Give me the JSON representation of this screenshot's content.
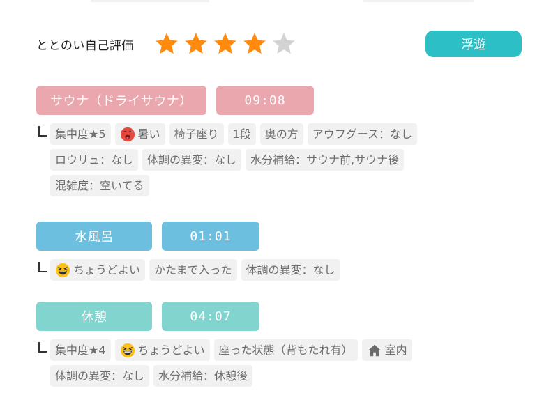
{
  "self_rating": {
    "label": "ととのい自己評価",
    "stars_filled": 4,
    "stars_total": 5,
    "star_color": "#ff8a0d",
    "star_empty_color": "#d3d3d3",
    "state_badge": "浮遊",
    "state_color": "#2cc0c6"
  },
  "sessions": [
    {
      "name": "サウナ（ドライサウナ）",
      "time": "09:08",
      "color": "#eaa7ad",
      "tags": [
        {
          "text": "集中度★5",
          "icon": null
        },
        {
          "text": "暑い",
          "icon": "hot-face-emoji"
        },
        {
          "text": "椅子座り",
          "icon": null
        },
        {
          "text": "1段",
          "icon": null
        },
        {
          "text": "奥の方",
          "icon": null
        },
        {
          "text": "アウフグース：なし",
          "icon": null
        },
        {
          "text": "ロウリュ：なし",
          "icon": null
        },
        {
          "text": "体調の異変：なし",
          "icon": null
        },
        {
          "text": "水分補給：サウナ前,サウナ後",
          "icon": null
        },
        {
          "text": "混雑度：空いてる",
          "icon": null
        }
      ]
    },
    {
      "name": "水風呂",
      "time": "01:01",
      "color": "#6cbfdf",
      "tags": [
        {
          "text": "ちょうどよい",
          "icon": "grinning-squinting-face-emoji"
        },
        {
          "text": "かたまで入った",
          "icon": null
        },
        {
          "text": "体調の異変：なし",
          "icon": null
        }
      ]
    },
    {
      "name": "休憩",
      "time": "04:07",
      "color": "#82d4cf",
      "tags": [
        {
          "text": "集中度★4",
          "icon": null
        },
        {
          "text": "ちょうどよい",
          "icon": "grinning-squinting-face-emoji"
        },
        {
          "text": "座った状態（背もたれ有）",
          "icon": null
        },
        {
          "text": "室内",
          "icon": "house-icon"
        },
        {
          "text": "体調の異変：なし",
          "icon": null
        },
        {
          "text": "水分補給：休憩後",
          "icon": null
        }
      ]
    }
  ]
}
